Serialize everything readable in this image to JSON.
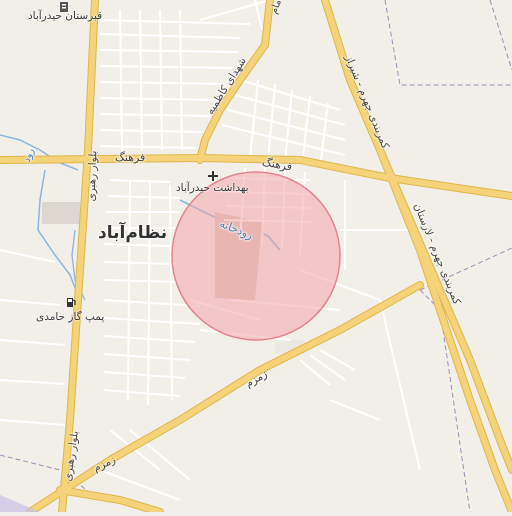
{
  "map": {
    "place_label": "نظام‌آباد",
    "road_labels": {
      "farhang_1": "فرهنگ",
      "farhang_2": "فرهنگ",
      "shohada": "شهدای کاظمیه",
      "blvd_rahbari_1": "بلوار رهبری",
      "blvd_rahbari_2": "بلوار رهبری",
      "highway_shiraz": "کمربندی جهرم - شیراز",
      "highway_larestan": "کمربندی جهرم - لارستان",
      "zamzam_1": "زمزم",
      "zamzam_2": "زمزم",
      "top_road": "آمام"
    },
    "water_labels": {
      "river": "رودخانه",
      "river_left": "رود"
    },
    "pois": {
      "cemetery": "قبرستان حیدرآباد",
      "health": "بهداشت حیدرآباد",
      "gas": "پمپ گاز حامدی"
    },
    "icons": {
      "cemetery": "cemetery-icon",
      "health": "health-cross-icon",
      "gas": "fuel-pump-icon"
    },
    "colors": {
      "background": "#f2efe9",
      "major_road": "#f4d37a",
      "major_road_casing": "#e0b64a",
      "minor_road": "#ffffff",
      "water": "#8ab6e0",
      "boundary": "#9a8fb8",
      "circle_fill": "#f4a6ad",
      "circle_stroke": "#e5838f"
    }
  }
}
